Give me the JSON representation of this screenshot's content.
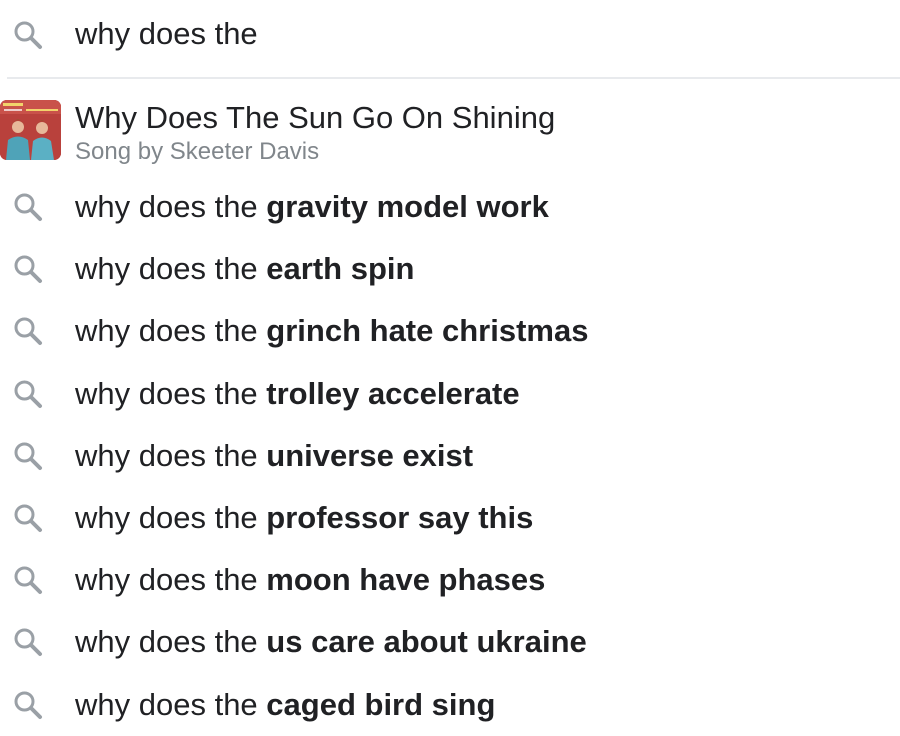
{
  "search": {
    "icon": "search-icon",
    "value": "why does the"
  },
  "rich_result": {
    "thumbnail_icon": "album-art-thumbnail",
    "title": "Why Does The Sun Go On Shining",
    "subtitle": "Song by Skeeter Davis"
  },
  "suggestions": [
    {
      "prefix": "why does the ",
      "completion": "gravity model work",
      "icon": "search-icon"
    },
    {
      "prefix": "why does the ",
      "completion": "earth spin",
      "icon": "search-icon"
    },
    {
      "prefix": "why does the ",
      "completion": "grinch hate christmas",
      "icon": "search-icon"
    },
    {
      "prefix": "why does the ",
      "completion": "trolley accelerate",
      "icon": "search-icon"
    },
    {
      "prefix": "why does the ",
      "completion": "universe exist",
      "icon": "search-icon"
    },
    {
      "prefix": "why does the ",
      "completion": "professor say this",
      "icon": "search-icon"
    },
    {
      "prefix": "why does the ",
      "completion": "moon have phases",
      "icon": "search-icon"
    },
    {
      "prefix": "why does the ",
      "completion": "us care about ukraine",
      "icon": "search-icon"
    },
    {
      "prefix": "why does the ",
      "completion": "caged bird sing",
      "icon": "search-icon"
    }
  ],
  "colors": {
    "text": "#202124",
    "subtext": "#80868b",
    "icon": "#9aa0a6",
    "divider": "#e8eaed"
  }
}
